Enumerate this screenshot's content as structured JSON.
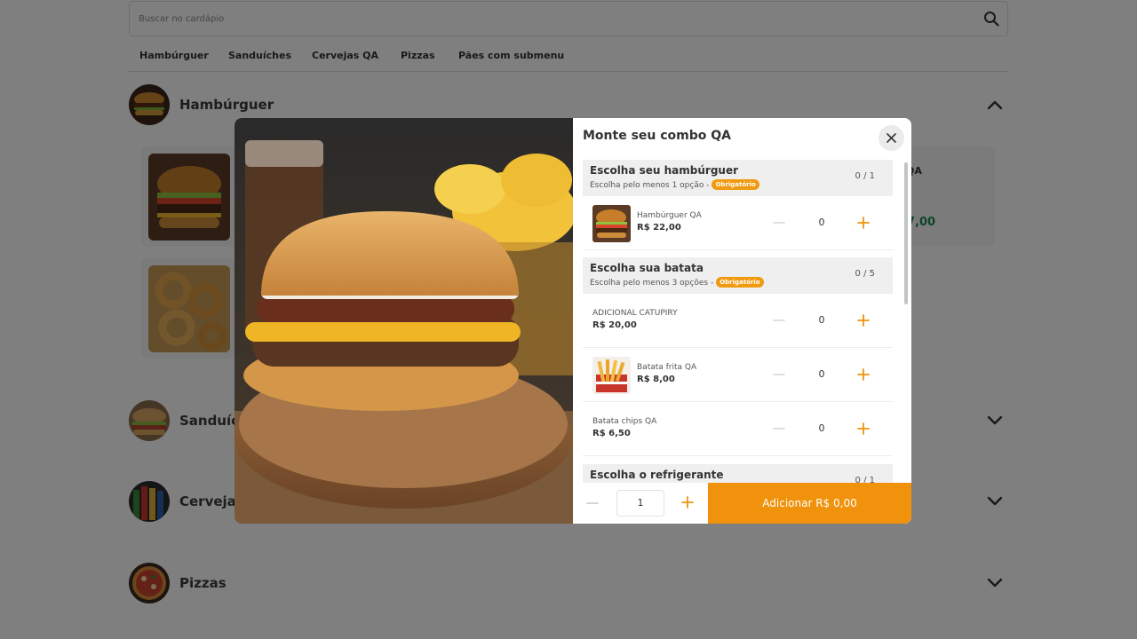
{
  "search": {
    "placeholder": "Buscar no cardápio",
    "icon": "search-icon"
  },
  "categories": [
    "Hambúrguer",
    "Sanduíches",
    "Cervejas QA",
    "Pizzas",
    "Pães com submenu"
  ],
  "sections": [
    {
      "title": "Hambúrguer",
      "expanded": true
    },
    {
      "title": "Sanduíches",
      "expanded": false
    },
    {
      "title": "Cervejas QA",
      "expanded": false
    },
    {
      "title": "Pizzas",
      "expanded": false
    }
  ],
  "background_card": {
    "name_fragment": "QA",
    "price_fragment": "7,00"
  },
  "modal": {
    "title": "Monte seu combo QA",
    "groups": [
      {
        "title": "Escolha seu hambúrguer",
        "subtitle": "Escolha pelo menos 1 opção -",
        "badge": "Obrigatório",
        "count": "0 / 1",
        "options": [
          {
            "name": "Hambúrguer QA",
            "price": "R$ 22,00",
            "qty": "0",
            "has_image": true
          }
        ]
      },
      {
        "title": "Escolha sua batata",
        "subtitle": "Escolha pelo menos 3 opções -",
        "badge": "Obrigatório",
        "count": "0 / 5",
        "options": [
          {
            "name": "ADICIONAL CATUPIRY",
            "price": "R$ 20,00",
            "qty": "0",
            "has_image": false
          },
          {
            "name": "Batata frita QA",
            "price": "R$ 8,00",
            "qty": "0",
            "has_image": true
          },
          {
            "name": "Batata chips QA",
            "price": "R$ 6,50",
            "qty": "0",
            "has_image": false
          }
        ]
      },
      {
        "title": "Escolha o refrigerante",
        "count": "0 / 1"
      }
    ],
    "footer": {
      "qty": "1",
      "add_label": "Adicionar R$ 0,00"
    }
  },
  "colors": {
    "accent": "#f0920b",
    "price_green": "#1a8a4a",
    "overlay": "rgba(0,0,0,0.5)"
  }
}
